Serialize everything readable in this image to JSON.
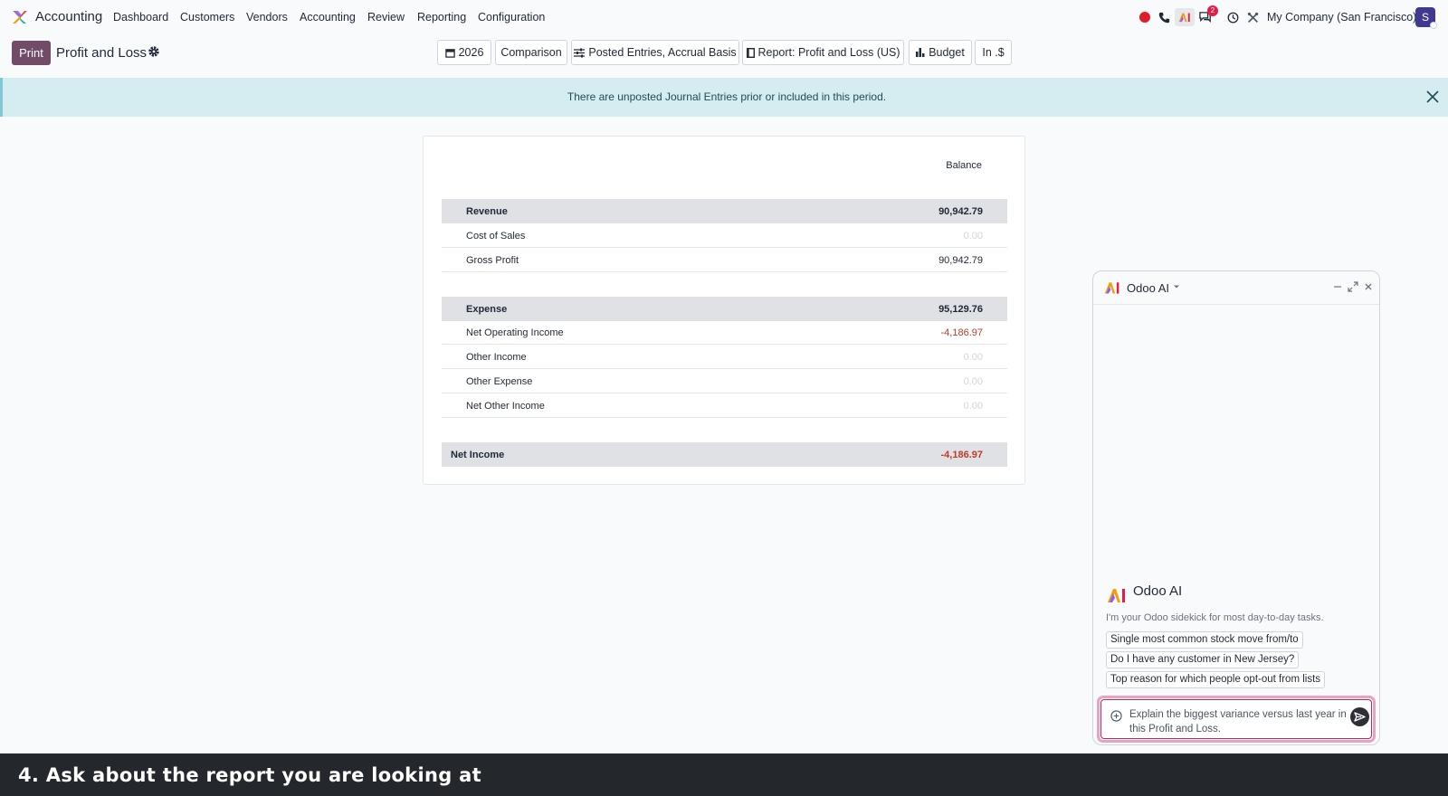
{
  "app": {
    "name": "Accounting",
    "menu": [
      "Dashboard",
      "Customers",
      "Vendors",
      "Accounting",
      "Review",
      "Reporting",
      "Configuration"
    ],
    "company": "My Company (San Francisco)",
    "avatar_letter": "S",
    "messages_badge": "2"
  },
  "toolbar": {
    "print_label": "Print",
    "page_title": "Profit and Loss",
    "filters": {
      "period": "2026",
      "comparison": "Comparison",
      "entries": "Posted Entries, Accrual Basis",
      "report": "Report: Profit and Loss (US)",
      "budget": "Budget",
      "currency": "In .$"
    }
  },
  "alert": {
    "text": "There are unposted Journal Entries prior or included in this period."
  },
  "report": {
    "column_header": "Balance",
    "rows": [
      {
        "label": "Revenue",
        "amount": "90,942.79",
        "style": "header"
      },
      {
        "label": "Cost of Sales",
        "amount": "0.00",
        "style": "zero"
      },
      {
        "label": "Gross Profit",
        "amount": "90,942.79",
        "style": "line"
      },
      {
        "label": "Expense",
        "amount": "95,129.76",
        "style": "header"
      },
      {
        "label": "Net Operating Income",
        "amount": "-4,186.97",
        "style": "neg"
      },
      {
        "label": "Other Income",
        "amount": "0.00",
        "style": "zero"
      },
      {
        "label": "Other Expense",
        "amount": "0.00",
        "style": "zero"
      },
      {
        "label": "Net Other Income",
        "amount": "0.00",
        "style": "zero"
      },
      {
        "label": "Net Income",
        "amount": "-4,186.97",
        "style": "total"
      }
    ]
  },
  "ai_panel": {
    "title": "Odoo AI",
    "heading": "Odoo AI",
    "description": "I'm your Odoo sidekick for most day-to-day tasks.",
    "suggestions": [
      "Single most common stock move from/to",
      "Do I have any customer in New Jersey?",
      "Top reason for which people opt-out from lists"
    ],
    "prompt": "Explain the biggest variance versus last year in this Profit and Loss."
  },
  "caption": "4. Ask about the report you are looking at",
  "colors": {
    "brand": "#714b67",
    "negative": "#c0392b",
    "alert_bg": "#d5ecf0"
  }
}
